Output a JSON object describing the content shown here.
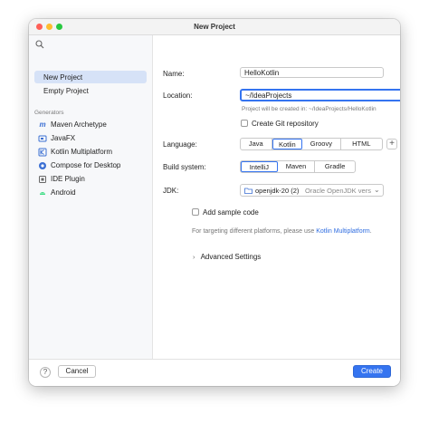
{
  "window": {
    "title": "New Project"
  },
  "sidebar": {
    "items": [
      {
        "label": "New Project",
        "selected": true
      },
      {
        "label": "Empty Project",
        "selected": false
      }
    ],
    "generators_label": "Generators",
    "generators": [
      {
        "label": "Maven Archetype",
        "icon": "maven-icon"
      },
      {
        "label": "JavaFX",
        "icon": "javafx-icon"
      },
      {
        "label": "Kotlin Multiplatform",
        "icon": "kotlin-icon"
      },
      {
        "label": "Compose for Desktop",
        "icon": "compose-icon"
      },
      {
        "label": "IDE Plugin",
        "icon": "plugin-icon"
      },
      {
        "label": "Android",
        "icon": "android-icon"
      }
    ]
  },
  "form": {
    "name_label": "Name:",
    "name_value": "HelloKotlin",
    "location_label": "Location:",
    "location_value": "~/IdeaProjects",
    "location_hint": "Project will be created in: ~/IdeaProjects/HelloKotlin",
    "git_label": "Create Git repository",
    "language_label": "Language:",
    "languages": [
      "Java",
      "Kotlin",
      "Groovy",
      "HTML"
    ],
    "language_selected": "Kotlin",
    "build_label": "Build system:",
    "build_systems": [
      "IntelliJ",
      "Maven",
      "Gradle"
    ],
    "build_selected": "IntelliJ",
    "jdk_label": "JDK:",
    "jdk_value": "openjdk-20 (2)",
    "jdk_detail": "Oracle OpenJDK vers",
    "sample_label": "Add sample code",
    "note_prefix": "For targeting different platforms, please use ",
    "note_link": "Kotlin Multiplatform",
    "note_suffix": ".",
    "advanced_label": "Advanced Settings"
  },
  "footer": {
    "help": "?",
    "cancel": "Cancel",
    "create": "Create"
  },
  "colors": {
    "accent": "#3574f0",
    "selection": "#d6e2f7"
  }
}
